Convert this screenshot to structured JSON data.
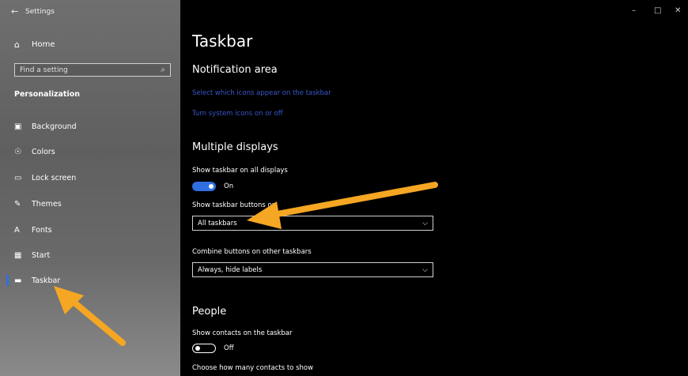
{
  "window": {
    "title": "Settings",
    "controls": {
      "minimize": "–",
      "maximize": "□",
      "close": "✕"
    }
  },
  "sidebar": {
    "home_label": "Home",
    "search_placeholder": "Find a setting",
    "section_title": "Personalization",
    "items": [
      {
        "label": "Background",
        "icon": "image-icon"
      },
      {
        "label": "Colors",
        "icon": "palette-icon"
      },
      {
        "label": "Lock screen",
        "icon": "lock-screen-icon"
      },
      {
        "label": "Themes",
        "icon": "brush-icon"
      },
      {
        "label": "Fonts",
        "icon": "font-icon"
      },
      {
        "label": "Start",
        "icon": "start-icon"
      },
      {
        "label": "Taskbar",
        "icon": "taskbar-icon",
        "active": true
      }
    ]
  },
  "main": {
    "title": "Taskbar",
    "notification_area": {
      "heading": "Notification area",
      "link_icons": "Select which icons appear on the taskbar",
      "link_system": "Turn system icons on or off"
    },
    "multiple_displays": {
      "heading": "Multiple displays",
      "show_all_label": "Show taskbar on all displays",
      "show_all_state": "On",
      "buttons_on_label": "Show taskbar buttons on",
      "buttons_on_value": "All taskbars",
      "combine_label": "Combine buttons on other taskbars",
      "combine_value": "Always, hide labels"
    },
    "people": {
      "heading": "People",
      "contacts_label": "Show contacts on the taskbar",
      "contacts_state": "Off",
      "count_label": "Choose how many contacts to show"
    }
  },
  "colors": {
    "accent": "#2f6fe0",
    "link": "#3a57c9",
    "annotation_arrow": "#f5a623"
  }
}
